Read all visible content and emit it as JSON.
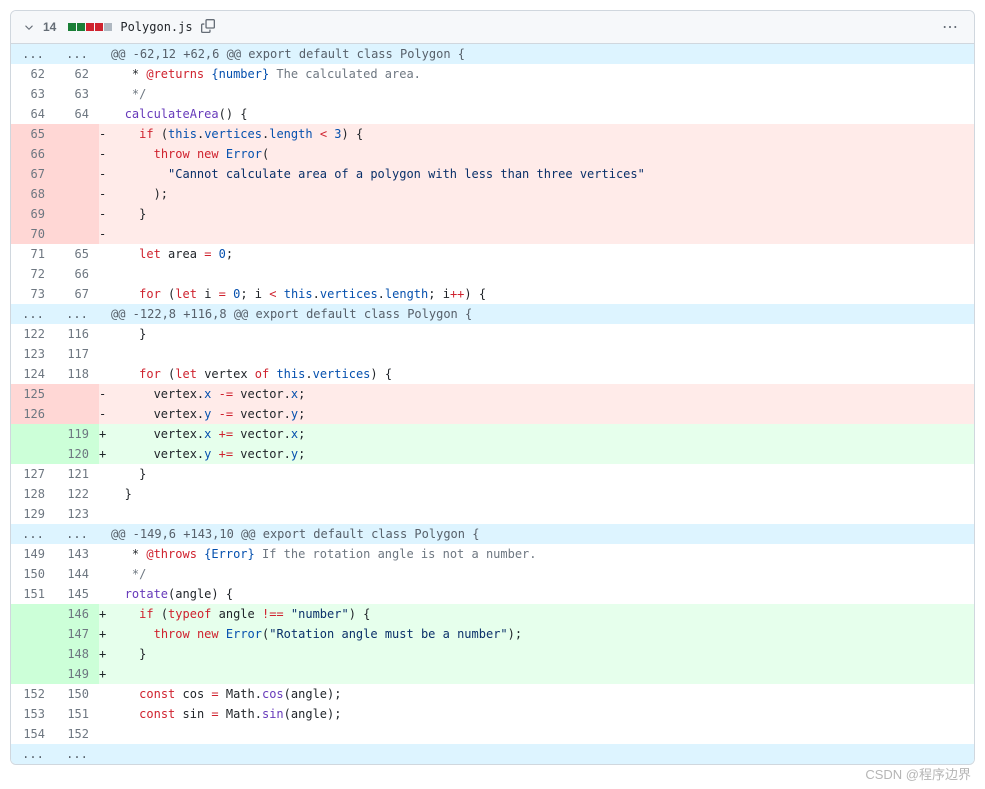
{
  "header": {
    "changed_lines": "14",
    "additions": 2,
    "deletions": 2,
    "neutral": 1,
    "filename": "Polygon.js"
  },
  "watermark": "CSDN @程序边界",
  "lines": [
    {
      "t": "hunk",
      "text": "@@ -62,12 +62,6 @@ export default class Polygon {"
    },
    {
      "t": "ctx",
      "o": "62",
      "n": "62",
      "seg": [
        [
          "c-pl",
          "   * "
        ],
        [
          "c-doctag",
          "@returns"
        ],
        [
          "c-pl",
          " "
        ],
        [
          "c-doctype",
          "{number}"
        ],
        [
          "c-cm",
          " The calculated area."
        ]
      ]
    },
    {
      "t": "ctx",
      "o": "63",
      "n": "63",
      "seg": [
        [
          "c-pl",
          "   "
        ],
        [
          "c-cm",
          "*/"
        ]
      ]
    },
    {
      "t": "ctx",
      "o": "64",
      "n": "64",
      "seg": [
        [
          "c-pl",
          "  "
        ],
        [
          "c-fn",
          "calculateArea"
        ],
        [
          "c-pl",
          "() {"
        ]
      ]
    },
    {
      "t": "del",
      "o": "65",
      "seg": [
        [
          "c-pl",
          "    "
        ],
        [
          "c-kw",
          "if"
        ],
        [
          "c-pl",
          " ("
        ],
        [
          "c-this",
          "this"
        ],
        [
          "c-pl",
          "."
        ],
        [
          "c-prop",
          "vertices"
        ],
        [
          "c-pl",
          "."
        ],
        [
          "c-prop",
          "length"
        ],
        [
          "c-pl",
          " "
        ],
        [
          "c-opr",
          "<"
        ],
        [
          "c-pl",
          " "
        ],
        [
          "c-num",
          "3"
        ],
        [
          "c-pl",
          ") {"
        ]
      ]
    },
    {
      "t": "del",
      "o": "66",
      "seg": [
        [
          "c-pl",
          "      "
        ],
        [
          "c-kw",
          "throw"
        ],
        [
          "c-pl",
          " "
        ],
        [
          "c-kw",
          "new"
        ],
        [
          "c-pl",
          " "
        ],
        [
          "c-cls",
          "Error"
        ],
        [
          "c-pl",
          "("
        ]
      ]
    },
    {
      "t": "del",
      "o": "67",
      "seg": [
        [
          "c-pl",
          "        "
        ],
        [
          "c-str",
          "\"Cannot calculate area of a polygon with less than three vertices\""
        ]
      ]
    },
    {
      "t": "del",
      "o": "68",
      "seg": [
        [
          "c-pl",
          "      );"
        ]
      ]
    },
    {
      "t": "del",
      "o": "69",
      "seg": [
        [
          "c-pl",
          "    }"
        ]
      ]
    },
    {
      "t": "del",
      "o": "70",
      "seg": [
        [
          "c-pl",
          ""
        ]
      ]
    },
    {
      "t": "ctx",
      "o": "71",
      "n": "65",
      "seg": [
        [
          "c-pl",
          "    "
        ],
        [
          "c-kw",
          "let"
        ],
        [
          "c-pl",
          " area "
        ],
        [
          "c-opr",
          "="
        ],
        [
          "c-pl",
          " "
        ],
        [
          "c-num",
          "0"
        ],
        [
          "c-pl",
          ";"
        ]
      ]
    },
    {
      "t": "ctx",
      "o": "72",
      "n": "66",
      "seg": [
        [
          "c-pl",
          ""
        ]
      ]
    },
    {
      "t": "ctx",
      "o": "73",
      "n": "67",
      "seg": [
        [
          "c-pl",
          "    "
        ],
        [
          "c-kw",
          "for"
        ],
        [
          "c-pl",
          " ("
        ],
        [
          "c-kw",
          "let"
        ],
        [
          "c-pl",
          " i "
        ],
        [
          "c-opr",
          "="
        ],
        [
          "c-pl",
          " "
        ],
        [
          "c-num",
          "0"
        ],
        [
          "c-pl",
          "; i "
        ],
        [
          "c-opr",
          "<"
        ],
        [
          "c-pl",
          " "
        ],
        [
          "c-this",
          "this"
        ],
        [
          "c-pl",
          "."
        ],
        [
          "c-prop",
          "vertices"
        ],
        [
          "c-pl",
          "."
        ],
        [
          "c-prop",
          "length"
        ],
        [
          "c-pl",
          "; i"
        ],
        [
          "c-opr",
          "++"
        ],
        [
          "c-pl",
          ") {"
        ]
      ]
    },
    {
      "t": "hunk",
      "text": "@@ -122,8 +116,8 @@ export default class Polygon {"
    },
    {
      "t": "ctx",
      "o": "122",
      "n": "116",
      "seg": [
        [
          "c-pl",
          "    }"
        ]
      ]
    },
    {
      "t": "ctx",
      "o": "123",
      "n": "117",
      "seg": [
        [
          "c-pl",
          ""
        ]
      ]
    },
    {
      "t": "ctx",
      "o": "124",
      "n": "118",
      "seg": [
        [
          "c-pl",
          "    "
        ],
        [
          "c-kw",
          "for"
        ],
        [
          "c-pl",
          " ("
        ],
        [
          "c-kw",
          "let"
        ],
        [
          "c-pl",
          " vertex "
        ],
        [
          "c-kw",
          "of"
        ],
        [
          "c-pl",
          " "
        ],
        [
          "c-this",
          "this"
        ],
        [
          "c-pl",
          "."
        ],
        [
          "c-prop",
          "vertices"
        ],
        [
          "c-pl",
          ") {"
        ]
      ]
    },
    {
      "t": "del",
      "o": "125",
      "seg": [
        [
          "c-pl",
          "      vertex."
        ],
        [
          "c-prop",
          "x"
        ],
        [
          "c-pl",
          " "
        ],
        [
          "c-opr",
          "-="
        ],
        [
          "c-pl",
          " vector."
        ],
        [
          "c-prop",
          "x"
        ],
        [
          "c-pl",
          ";"
        ]
      ]
    },
    {
      "t": "del",
      "o": "126",
      "seg": [
        [
          "c-pl",
          "      vertex."
        ],
        [
          "c-prop",
          "y"
        ],
        [
          "c-pl",
          " "
        ],
        [
          "c-opr",
          "-="
        ],
        [
          "c-pl",
          " vector."
        ],
        [
          "c-prop",
          "y"
        ],
        [
          "c-pl",
          ";"
        ]
      ]
    },
    {
      "t": "add",
      "n": "119",
      "seg": [
        [
          "c-pl",
          "      vertex."
        ],
        [
          "c-prop",
          "x"
        ],
        [
          "c-pl",
          " "
        ],
        [
          "c-opr",
          "+="
        ],
        [
          "c-pl",
          " vector."
        ],
        [
          "c-prop",
          "x"
        ],
        [
          "c-pl",
          ";"
        ]
      ]
    },
    {
      "t": "add",
      "n": "120",
      "seg": [
        [
          "c-pl",
          "      vertex."
        ],
        [
          "c-prop",
          "y"
        ],
        [
          "c-pl",
          " "
        ],
        [
          "c-opr",
          "+="
        ],
        [
          "c-pl",
          " vector."
        ],
        [
          "c-prop",
          "y"
        ],
        [
          "c-pl",
          ";"
        ]
      ]
    },
    {
      "t": "ctx",
      "o": "127",
      "n": "121",
      "seg": [
        [
          "c-pl",
          "    }"
        ]
      ]
    },
    {
      "t": "ctx",
      "o": "128",
      "n": "122",
      "seg": [
        [
          "c-pl",
          "  }"
        ]
      ]
    },
    {
      "t": "ctx",
      "o": "129",
      "n": "123",
      "seg": [
        [
          "c-pl",
          ""
        ]
      ]
    },
    {
      "t": "hunk",
      "text": "@@ -149,6 +143,10 @@ export default class Polygon {"
    },
    {
      "t": "ctx",
      "o": "149",
      "n": "143",
      "seg": [
        [
          "c-pl",
          "   * "
        ],
        [
          "c-doctag",
          "@throws"
        ],
        [
          "c-pl",
          " "
        ],
        [
          "c-doctype",
          "{Error}"
        ],
        [
          "c-cm",
          " If the rotation angle is not a number."
        ]
      ]
    },
    {
      "t": "ctx",
      "o": "150",
      "n": "144",
      "seg": [
        [
          "c-pl",
          "   "
        ],
        [
          "c-cm",
          "*/"
        ]
      ]
    },
    {
      "t": "ctx",
      "o": "151",
      "n": "145",
      "seg": [
        [
          "c-pl",
          "  "
        ],
        [
          "c-fn",
          "rotate"
        ],
        [
          "c-pl",
          "(angle) {"
        ]
      ]
    },
    {
      "t": "add",
      "n": "146",
      "seg": [
        [
          "c-pl",
          "    "
        ],
        [
          "c-kw",
          "if"
        ],
        [
          "c-pl",
          " ("
        ],
        [
          "c-kw",
          "typeof"
        ],
        [
          "c-pl",
          " angle "
        ],
        [
          "c-opr",
          "!=="
        ],
        [
          "c-pl",
          " "
        ],
        [
          "c-str",
          "\"number\""
        ],
        [
          "c-pl",
          ") {"
        ]
      ]
    },
    {
      "t": "add",
      "n": "147",
      "seg": [
        [
          "c-pl",
          "      "
        ],
        [
          "c-kw",
          "throw"
        ],
        [
          "c-pl",
          " "
        ],
        [
          "c-kw",
          "new"
        ],
        [
          "c-pl",
          " "
        ],
        [
          "c-cls",
          "Error"
        ],
        [
          "c-pl",
          "("
        ],
        [
          "c-str",
          "\"Rotation angle must be a number\""
        ],
        [
          "c-pl",
          ");"
        ]
      ]
    },
    {
      "t": "add",
      "n": "148",
      "seg": [
        [
          "c-pl",
          "    }"
        ]
      ]
    },
    {
      "t": "add",
      "n": "149",
      "seg": [
        [
          "c-pl",
          ""
        ]
      ]
    },
    {
      "t": "ctx",
      "o": "152",
      "n": "150",
      "seg": [
        [
          "c-pl",
          "    "
        ],
        [
          "c-kw",
          "const"
        ],
        [
          "c-pl",
          " cos "
        ],
        [
          "c-opr",
          "="
        ],
        [
          "c-pl",
          " Math."
        ],
        [
          "c-fn",
          "cos"
        ],
        [
          "c-pl",
          "(angle);"
        ]
      ]
    },
    {
      "t": "ctx",
      "o": "153",
      "n": "151",
      "seg": [
        [
          "c-pl",
          "    "
        ],
        [
          "c-kw",
          "const"
        ],
        [
          "c-pl",
          " sin "
        ],
        [
          "c-opr",
          "="
        ],
        [
          "c-pl",
          " Math."
        ],
        [
          "c-fn",
          "sin"
        ],
        [
          "c-pl",
          "(angle);"
        ]
      ]
    },
    {
      "t": "ctx",
      "o": "154",
      "n": "152",
      "seg": [
        [
          "c-pl",
          ""
        ]
      ]
    },
    {
      "t": "hunk",
      "text": ""
    }
  ]
}
